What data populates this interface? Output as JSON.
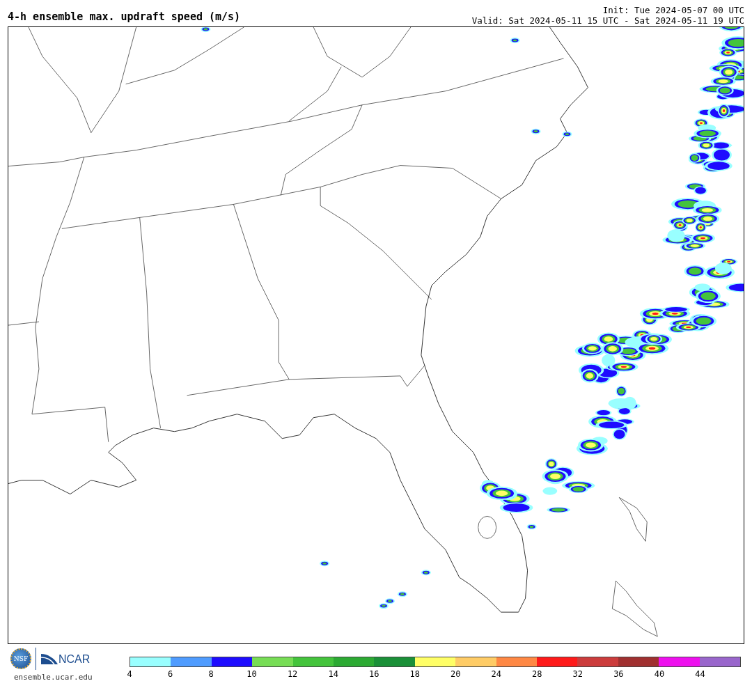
{
  "header": {
    "title": "4-h ensemble max. updraft speed (m/s)",
    "init": "Init: Tue 2024-05-07 00 UTC",
    "valid": "Valid: Sat 2024-05-11 15 UTC - Sat 2024-05-11 19 UTC"
  },
  "footer": {
    "logos": [
      {
        "kind": "nsf",
        "text": "NSF"
      },
      {
        "kind": "ncar",
        "text": "NCAR"
      }
    ],
    "url": "ensemble.ucar.edu"
  },
  "colorbar": {
    "bins": [
      {
        "color": "#99ffff",
        "tick": "4"
      },
      {
        "color": "#4f9cff",
        "tick": "6"
      },
      {
        "color": "#1e0cff",
        "tick": "8"
      },
      {
        "color": "#77dd55",
        "tick": "10"
      },
      {
        "color": "#44c43c",
        "tick": "12"
      },
      {
        "color": "#2caa33",
        "tick": "14"
      },
      {
        "color": "#1b9038",
        "tick": "16"
      },
      {
        "color": "#ffff66",
        "tick": "18"
      },
      {
        "color": "#ffcc66",
        "tick": "20"
      },
      {
        "color": "#ff8844",
        "tick": "24"
      },
      {
        "color": "#ff1a1a",
        "tick": "28"
      },
      {
        "color": "#cc3c3c",
        "tick": "32"
      },
      {
        "color": "#a03030",
        "tick": "36"
      },
      {
        "color": "#ee10ee",
        "tick": "40"
      },
      {
        "color": "#9966cc",
        "tick": "44"
      }
    ]
  }
}
